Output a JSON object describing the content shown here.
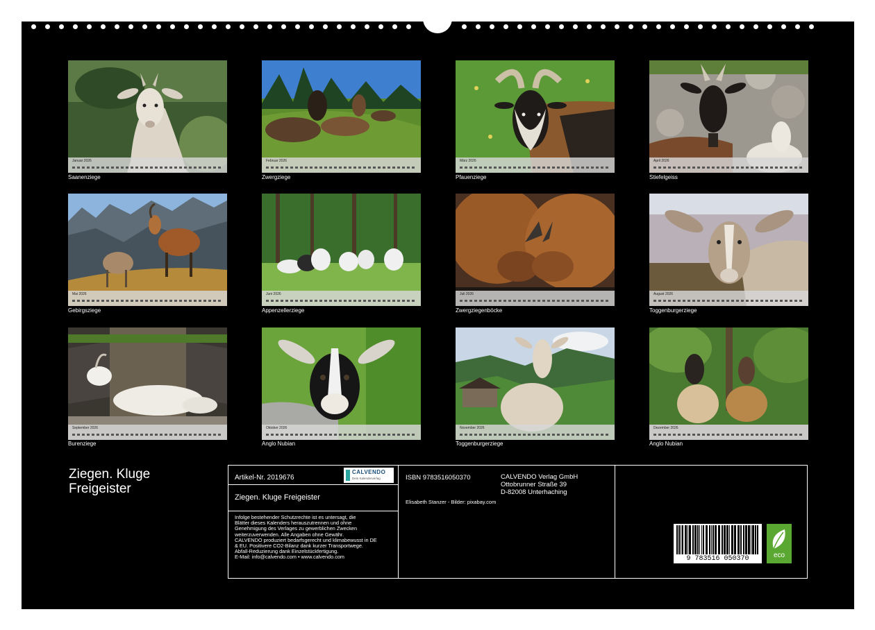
{
  "calendar": {
    "months": [
      {
        "month": "Januar 2026",
        "caption": "Saanenziege"
      },
      {
        "month": "Februar 2026",
        "caption": "Zwergziege"
      },
      {
        "month": "März 2026",
        "caption": "Pfauenziege"
      },
      {
        "month": "April 2026",
        "caption": "Stiefelgeiss"
      },
      {
        "month": "Mai 2026",
        "caption": "Gebirgsziege"
      },
      {
        "month": "Juni 2026",
        "caption": "Appenzellerziege"
      },
      {
        "month": "Juli 2026",
        "caption": "Zwergziegenböcke"
      },
      {
        "month": "August 2026",
        "caption": "Toggenburgerziege"
      },
      {
        "month": "September 2026",
        "caption": "Burenziege"
      },
      {
        "month": "Oktober 2026",
        "caption": "Anglo Nubian"
      },
      {
        "month": "November 2026",
        "caption": "Toggenburgerziege"
      },
      {
        "month": "Dezember 2026",
        "caption": "Anglo Nubian"
      }
    ]
  },
  "title": {
    "line1": "Ziegen. Kluge",
    "line2": "Freigeister"
  },
  "info": {
    "article": "Artikel-Nr. 2019676",
    "logo_text": "CALVENDO",
    "logo_sub": "Dein Kalenderverlag",
    "product_title": "Ziegen. Kluge Freigeister",
    "legal": [
      "Infolge bestehender Schutzrechte ist es untersagt, die",
      "Blätter dieses Kalenders herauszutrennen und ohne",
      "Genehmigung des Verlages zu gewerblichen Zwecken",
      "weiterzuverwenden. Alle Angaben ohne Gewähr.",
      "CALVENDO produziert bedarfsgerecht und klimabewusst in DE",
      "& EU. Positivere CO2-Bilanz dank kurzer Transportwege.",
      "Abfall-Reduzierung dank Einzelstückfertigung.",
      "E-Mail: info@calvendo.com • www.calvendo.com"
    ],
    "isbn": "ISBN 9783516050370",
    "publisher": [
      "CALVENDO Verlag GmbH",
      "Ottobrunner Straße 39",
      "D-82008 Unterhaching"
    ],
    "credits": "Elisabeth Stanzer - Bilder: pixabay.com",
    "barcode_digits": "9 783516 050370",
    "eco_label": "eco"
  },
  "colors": {
    "background": "#000000",
    "text": "#ffffff",
    "eco_green": "#5aa832"
  }
}
